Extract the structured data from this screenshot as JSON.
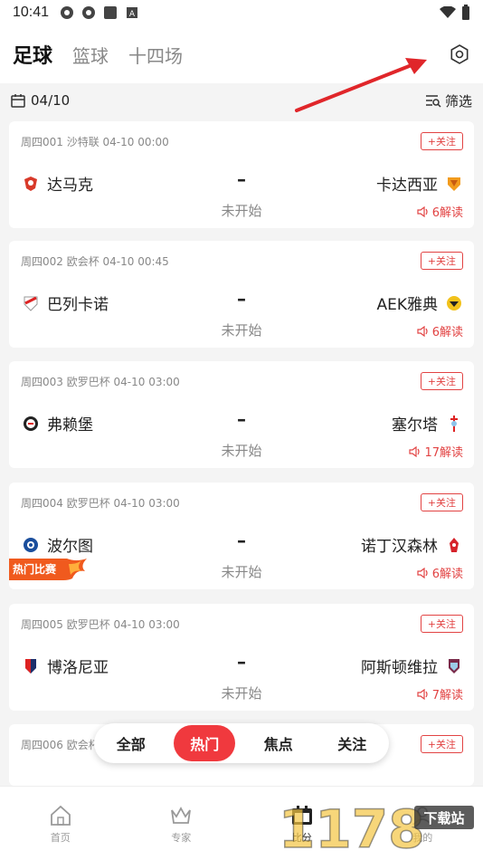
{
  "status_bar": {
    "time": "10:41"
  },
  "top_tabs": [
    {
      "label": "足球",
      "active": true
    },
    {
      "label": "篮球",
      "active": false
    },
    {
      "label": "十四场",
      "active": false
    }
  ],
  "date_bar": {
    "date": "04/10",
    "filter_label": "筛选"
  },
  "matches": [
    {
      "meta": "周四001 沙特联 04-10 00:00",
      "follow": "+关注",
      "home": "达马克",
      "away": "卡达西亚",
      "vs": "–",
      "status": "未开始",
      "reads": "6解读"
    },
    {
      "meta": "周四002 欧会杯 04-10 00:45",
      "follow": "+关注",
      "home": "巴列卡诺",
      "away": "AEK雅典",
      "vs": "–",
      "status": "未开始",
      "reads": "6解读"
    },
    {
      "meta": "周四003 欧罗巴杯 04-10 03:00",
      "follow": "+关注",
      "home": "弗赖堡",
      "away": "塞尔塔",
      "vs": "–",
      "status": "未开始",
      "reads": "17解读"
    },
    {
      "meta": "周四004 欧罗巴杯 04-10 03:00",
      "follow": "+关注",
      "home": "波尔图",
      "away": "诺丁汉森林",
      "vs": "–",
      "status": "未开始",
      "reads": "6解读"
    },
    {
      "meta": "周四005 欧罗巴杯 04-10 03:00",
      "follow": "+关注",
      "home": "博洛尼亚",
      "away": "阿斯顿维拉",
      "vs": "–",
      "status": "未开始",
      "reads": "7解读"
    },
    {
      "meta": "周四006 欧会杯",
      "follow": "+关注"
    }
  ],
  "hot_badge": "热门比赛",
  "filter_pill": {
    "items": [
      "全部",
      "热门",
      "焦点",
      "关注"
    ],
    "active": "热门"
  },
  "bottom_nav": [
    {
      "label": "首页",
      "icon": "home-icon"
    },
    {
      "label": "专家",
      "icon": "crown-icon"
    },
    {
      "label": "比分",
      "icon": "calendar-icon",
      "active": true
    },
    {
      "label": "我的",
      "icon": "user-icon"
    }
  ],
  "watermark": {
    "text": "下载站",
    "number": "1178"
  },
  "colors": {
    "accent": "#f0393e",
    "link_red": "#e24343",
    "background": "#f4f4f4"
  }
}
